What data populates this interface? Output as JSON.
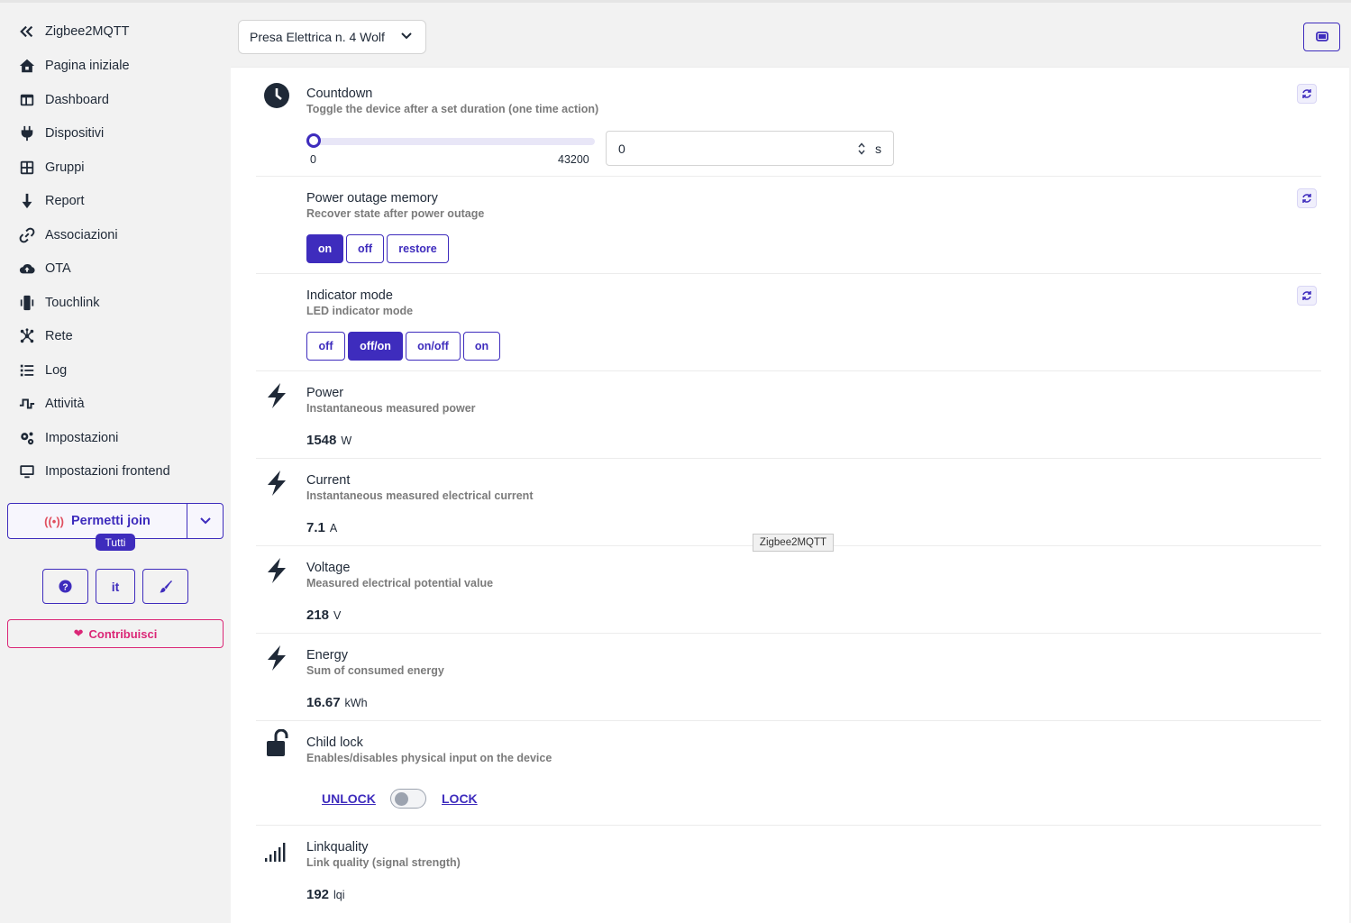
{
  "sidebar": {
    "brand": "Zigbee2MQTT",
    "items": [
      {
        "label": "Pagina iniziale",
        "icon": "home-icon"
      },
      {
        "label": "Dashboard",
        "icon": "dashboard-icon"
      },
      {
        "label": "Dispositivi",
        "icon": "plug-icon"
      },
      {
        "label": "Gruppi",
        "icon": "grid-icon"
      },
      {
        "label": "Report",
        "icon": "arrow-down-icon"
      },
      {
        "label": "Associazioni",
        "icon": "link-icon"
      },
      {
        "label": "OTA",
        "icon": "cloud-upload-icon"
      },
      {
        "label": "Touchlink",
        "icon": "mobile-vibrate-icon"
      },
      {
        "label": "Rete",
        "icon": "network-icon"
      },
      {
        "label": "Log",
        "icon": "list-icon"
      },
      {
        "label": "Attività",
        "icon": "wave-icon"
      },
      {
        "label": "Impostazioni",
        "icon": "gears-icon"
      },
      {
        "label": "Impostazioni frontend",
        "icon": "desktop-icon"
      }
    ],
    "permit_join": {
      "label": "Permetti join",
      "target": "Tutti"
    },
    "help_icon": "question-icon",
    "language": "it",
    "theme_icon": "brush-icon",
    "contribute": "Contribuisci"
  },
  "header": {
    "device": "Presa Elettrica n. 4 Wolf",
    "screen_icon": "display-icon"
  },
  "features": {
    "countdown": {
      "title": "Countdown",
      "desc": "Toggle the device after a set duration (one time action)",
      "min": "0",
      "max": "43200",
      "value": "0",
      "unit": "s",
      "slider_fraction": 0
    },
    "power_outage": {
      "title": "Power outage memory",
      "desc": "Recover state after power outage",
      "options": [
        "on",
        "off",
        "restore"
      ],
      "selected": "on"
    },
    "indicator": {
      "title": "Indicator mode",
      "desc": "LED indicator mode",
      "options": [
        "off",
        "off/on",
        "on/off",
        "on"
      ],
      "selected": "off/on"
    },
    "power": {
      "title": "Power",
      "desc": "Instantaneous measured power",
      "value": "1548",
      "unit": "W"
    },
    "current": {
      "title": "Current",
      "desc": "Instantaneous measured electrical current",
      "value": "7.1",
      "unit": "A"
    },
    "voltage": {
      "title": "Voltage",
      "desc": "Measured electrical potential value",
      "value": "218",
      "unit": "V"
    },
    "energy": {
      "title": "Energy",
      "desc": "Sum of consumed energy",
      "value": "16.67",
      "unit": "kWh"
    },
    "child_lock": {
      "title": "Child lock",
      "desc": "Enables/disables physical input on the device",
      "off_label": "UNLOCK",
      "on_label": "LOCK",
      "state": "UNLOCK"
    },
    "linkquality": {
      "title": "Linkquality",
      "desc": "Link quality (signal strength)",
      "value": "192",
      "unit": "lqi"
    }
  },
  "tooltip": "Zigbee2MQTT",
  "colors": {
    "accent": "#3e2cbd",
    "pink": "#db2777",
    "antenna": "#e04f5f"
  }
}
